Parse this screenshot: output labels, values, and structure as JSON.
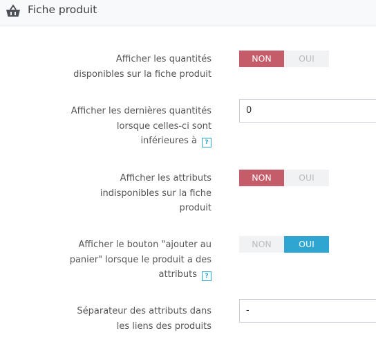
{
  "header": {
    "title": "Fiche produit",
    "icon": "basket-icon"
  },
  "rows": [
    {
      "label_lines": [
        "Afficher les quantités",
        "disponibles sur la fiche produit"
      ],
      "no": "NON",
      "yes": "OUI",
      "value": "NON"
    },
    {
      "label_lines": [
        "Afficher les dernières quantités",
        "lorsque celles-ci sont",
        "inférieures à"
      ],
      "help": "?",
      "value": "0"
    },
    {
      "label_lines": [
        "Afficher les attributs",
        "indisponibles sur la fiche",
        "produit"
      ],
      "no": "NON",
      "yes": "OUI",
      "value": "NON"
    },
    {
      "label_lines": [
        "Afficher le bouton \"ajouter au",
        "panier\" lorsque le produit a des",
        "attributs"
      ],
      "help": "?",
      "no": "NON",
      "yes": "OUI",
      "value": "OUI"
    },
    {
      "label_lines": [
        "Séparateur des attributs dans",
        "les liens des produits"
      ],
      "value": "-"
    }
  ],
  "colors": {
    "active_no": "#c45c6a",
    "active_yes": "#2fa6d2",
    "inactive": "#f1f2f3"
  }
}
